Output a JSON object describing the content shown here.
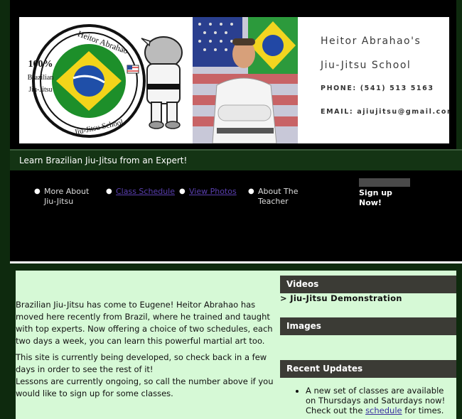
{
  "banner": {
    "logo": {
      "percent": "100%",
      "line1": "Brazilian",
      "line2": "Jiu-Jitsu",
      "ring_top": "Heitor Abrahao",
      "ring_bottom": "Jiu-Jitsu School"
    },
    "title_line1": "Heitor Abrahao's",
    "title_line2": "Jiu-Jitsu School",
    "phone": "PHONE: (541) 513 5163",
    "email": "EMAIL: ajiujitsu@gmail.com"
  },
  "tagline": "Learn Brazilian Jiu-Jitsu from an Expert!",
  "nav": {
    "items": [
      {
        "label": "More About Jiu-Jitsu",
        "link": false
      },
      {
        "label": "Class Schedule",
        "link": true
      },
      {
        "label": "View Photos",
        "link": true
      },
      {
        "label": "About The Teacher",
        "link": false
      }
    ],
    "signup": "Sign up Now!"
  },
  "main": {
    "intro_p1": "Brazilian Jiu-Jitsu has come to Eugene! Heitor Abrahao has moved here recently from Brazil, where he trained and taught with top experts. Now offering a choice of two schedules, each two days a week, you can learn this powerful martial art too.",
    "intro_p2": "This site is currently being developed, so check back in a few days in order to see the rest of it!",
    "intro_p3": "Lessons are currently ongoing, so call the number above if you would like to sign up for some classes."
  },
  "sidebar": {
    "videos_heading": "Videos",
    "video_link": "> Jiu-Jitsu Demonstration",
    "images_heading": "Images",
    "updates_heading": "Recent Updates",
    "update_before": "A new set of classes are available on Thursdays and Saturdays now! Check out the ",
    "update_link": "schedule",
    "update_after": " for times."
  },
  "colors": {
    "frame_green": "#0e2a0e",
    "panel_green": "#d6f9d6",
    "sidebar_head": "#3b3b35",
    "link_purple": "#5a3fb0"
  }
}
